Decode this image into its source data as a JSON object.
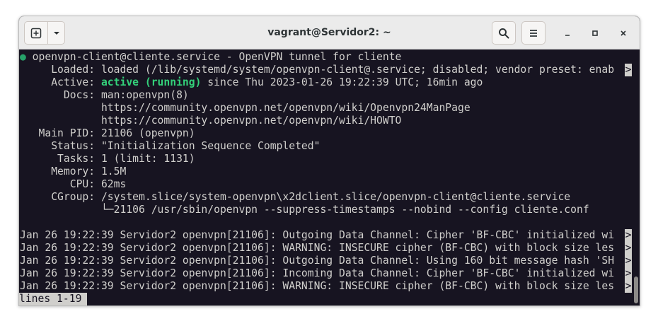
{
  "window": {
    "title": "vagrant@Servidor2: ~"
  },
  "toolbar": {
    "icons": [
      "new-tab-icon",
      "chevron-down-icon",
      "search-icon",
      "hamburger-menu-icon",
      "minimize-icon",
      "maximize-icon",
      "close-icon"
    ]
  },
  "terminal": {
    "unit_dot": "●",
    "unit_header": " openvpn-client@cliente.service - OpenVPN tunnel for cliente",
    "loaded": "     Loaded: loaded (/lib/systemd/system/openvpn-client@.service; disabled; vendor preset: enab",
    "active_label": "     Active: ",
    "active_state": "active (running)",
    "active_rest": " since Thu 2023-01-26 19:22:39 UTC; 16min ago",
    "docs": "       Docs: man:openvpn(8)",
    "docs_url1": "             https://community.openvpn.net/openvpn/wiki/Openvpn24ManPage",
    "docs_url2": "             https://community.openvpn.net/openvpn/wiki/HOWTO",
    "main_pid": "   Main PID: 21106 (openvpn)",
    "status": "     Status: \"Initialization Sequence Completed\"",
    "tasks": "      Tasks: 1 (limit: 1131)",
    "memory": "     Memory: 1.5M",
    "cpu": "        CPU: 62ms",
    "cgroup": "     CGroup: /system.slice/system-openvpn\\x2dclient.slice/openvpn-client@cliente.service",
    "cgroup_proc": "             └─21106 /usr/sbin/openvpn --suppress-timestamps --nobind --config cliente.conf",
    "logs": [
      "Jan 26 19:22:39 Servidor2 openvpn[21106]: Outgoing Data Channel: Cipher 'BF-CBC' initialized wi",
      "Jan 26 19:22:39 Servidor2 openvpn[21106]: WARNING: INSECURE cipher (BF-CBC) with block size les",
      "Jan 26 19:22:39 Servidor2 openvpn[21106]: Outgoing Data Channel: Using 160 bit message hash 'SH",
      "Jan 26 19:22:39 Servidor2 openvpn[21106]: Incoming Data Channel: Cipher 'BF-CBC' initialized wi",
      "Jan 26 19:22:39 Servidor2 openvpn[21106]: WARNING: INSECURE cipher (BF-CBC) with block size les"
    ],
    "truncation_marker": ">",
    "pager_status": "lines 1-19"
  },
  "colors": {
    "terminal_bg": "#171421",
    "terminal_fg": "#d0cfcc",
    "active_green": "#33d17a",
    "dot_green": "#26a269"
  }
}
